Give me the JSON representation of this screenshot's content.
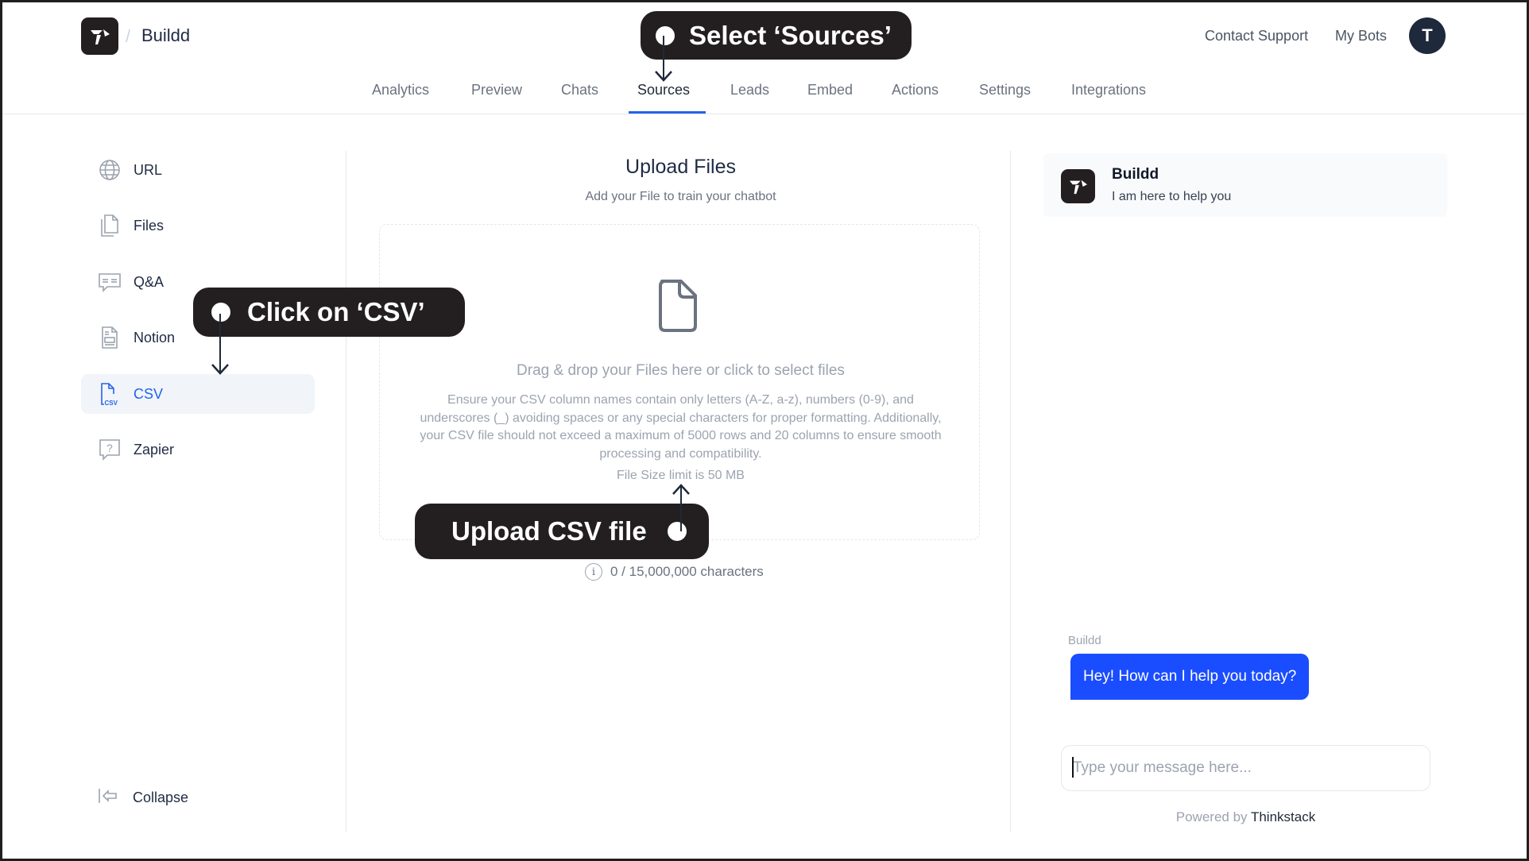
{
  "header": {
    "brand": "Buildd",
    "separator": "/",
    "links": [
      {
        "label": "Contact Support"
      },
      {
        "label": "My Bots"
      }
    ],
    "avatar_initial": "T"
  },
  "tabs": [
    {
      "label": "Analytics",
      "active": false
    },
    {
      "label": "Preview",
      "active": false
    },
    {
      "label": "Chats",
      "active": false
    },
    {
      "label": "Sources",
      "active": true
    },
    {
      "label": "Leads",
      "active": false
    },
    {
      "label": "Embed",
      "active": false
    },
    {
      "label": "Actions",
      "active": false
    },
    {
      "label": "Settings",
      "active": false
    },
    {
      "label": "Integrations",
      "active": false
    }
  ],
  "sidebar": {
    "items": [
      {
        "label": "URL",
        "icon": "globe-icon",
        "active": false
      },
      {
        "label": "Files",
        "icon": "files-icon",
        "active": false
      },
      {
        "label": "Q&A",
        "icon": "qa-icon",
        "active": false
      },
      {
        "label": "Notion",
        "icon": "notion-icon",
        "active": false
      },
      {
        "label": "CSV",
        "icon": "csv-file-icon",
        "active": true
      },
      {
        "label": "Zapier",
        "icon": "question-icon",
        "active": false
      }
    ],
    "collapse_label": "Collapse"
  },
  "upload": {
    "title": "Upload Files",
    "subtitle": "Add your File to train your chatbot",
    "dropzone_text": "Drag & drop your Files here or click to select files",
    "note": "Ensure your CSV column names contain only letters (A-Z, a-z), numbers (0-9), and underscores (_) avoiding spaces or any special characters for proper formatting. Additionally, your CSV file should not exceed a maximum of 5000 rows and 20 columns to ensure smooth processing and compatibility.",
    "size_limit": "File Size limit is 50 MB",
    "char_count": "0 / 15,000,000 characters"
  },
  "chat": {
    "bot_name": "Buildd",
    "tagline": "I am here to help you",
    "sender_label": "Buildd",
    "greeting": "Hey! How can I help you today?",
    "input_placeholder": "Type your message here...",
    "powered_prefix": "Powered by",
    "powered_brand": "Thinkstack"
  },
  "callouts": {
    "sources": "Select ‘Sources’",
    "csv": "Click on ‘CSV’",
    "upload": "Upload CSV file"
  },
  "colors": {
    "accent": "#2563eb",
    "bubble": "#1a4dff",
    "callout_bg": "#231f20"
  }
}
